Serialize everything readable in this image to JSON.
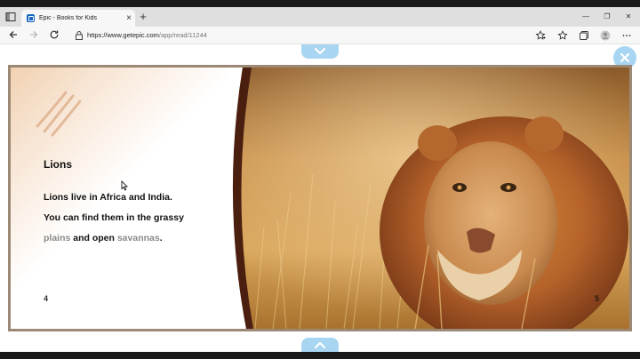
{
  "browser": {
    "tab": {
      "title": "Epic - Books for Kids",
      "favicon": "epic-favicon-icon"
    },
    "close_tab_glyph": "×",
    "new_tab_glyph": "+",
    "window_controls": {
      "minimize": "—",
      "maximize": "❐",
      "close": "✕"
    },
    "address": {
      "host": "https://www.getepic.com",
      "path": "/app/read/11244"
    }
  },
  "reader": {
    "left_page": {
      "heading": "Lions",
      "lines": [
        {
          "text": "Lions live in Africa and India."
        },
        {
          "text": "You can find them in the grassy"
        },
        {
          "vocab1": "plains",
          "middle": " and open ",
          "vocab2": "savannas",
          "end": "."
        }
      ],
      "page_number": "4"
    },
    "right_page": {
      "page_number": "5",
      "image": "lion-photo"
    }
  },
  "colors": {
    "arrow_tab": "#a8d6f2",
    "book_border": "#9c8975",
    "vocab_text": "#8a8a8a",
    "page_gradient": "#f1d2b2"
  }
}
